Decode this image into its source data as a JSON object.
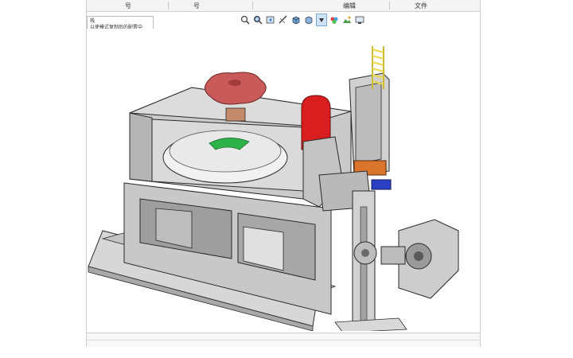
{
  "menubar": {
    "item_1": "号",
    "item_2": "号",
    "item_3": "编辑",
    "item_4": "文件"
  },
  "tooltip": {
    "line_1": "栈",
    "line_2": "以使模式复制后的配置中"
  },
  "toolbar_icons": [
    "zoom-to-fit-icon",
    "zoom-area-icon",
    "previous-view-icon",
    "section-view-icon",
    "view-orientation-icon",
    "display-style-icon",
    "hide-show-icon",
    "edit-appearance-icon",
    "apply-scene-icon",
    "view-settings-icon"
  ],
  "colors": {
    "part_gray": "#c9c9c9",
    "knob_red": "#c85a5a",
    "bolt_red": "#d81e1e",
    "accent_green": "#2db34a",
    "accent_orange": "#d9752c",
    "accent_blue": "#2b3fc4",
    "spring_yellow": "#e8d84a",
    "edge_dark": "#2a2a2a"
  }
}
